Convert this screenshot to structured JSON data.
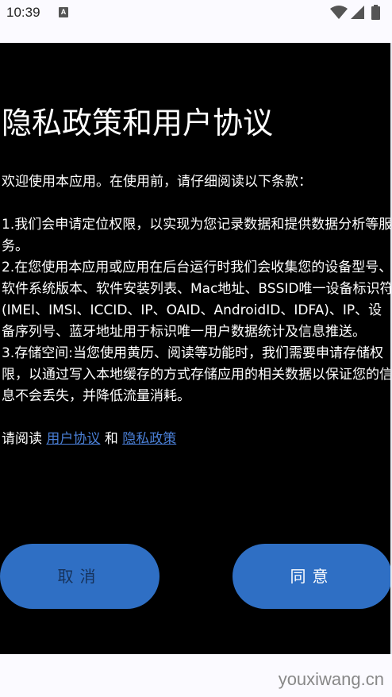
{
  "status_bar": {
    "time": "10:39",
    "notification_letter": "A",
    "icons": [
      "wifi-icon",
      "signal-icon",
      "battery-icon"
    ]
  },
  "dialog": {
    "title": "隐私政策和用户协议",
    "intro": "欢迎使用本应用。在使用前，请仔细阅读以下条款：",
    "terms": [
      "1.我们会申请定位权限，以实现为您记录数据和提供数据分析等服务。",
      "2.在您使用本应用或应用在后台运行时我们会收集您的设备型号、软件系统版本、软件安装列表、Mac地址、BSSID唯一设备标识符(IMEI、IMSI、ICCID、IP、OAID、AndroidID、IDFA)、IP、设备序列号、蓝牙地址用于标识唯一用户数据统计及信息推送。",
      "3.存储空间:当您使用黄历、阅读等功能时，我们需要申请存储权限，以通过写入本地缓存的方式存储应用的相关数据以保证您的信息不会丢失，并降低流量消耗。"
    ],
    "agree_prefix": "请阅读",
    "user_agreement_link": "用户协议",
    "conjunction": "和",
    "privacy_policy_link": "隐私政策",
    "cancel_label": "取消",
    "agree_label": "同意"
  },
  "watermark": "youxiwang.cn",
  "colors": {
    "dialog_background": "#000000",
    "button_blue": "#2f6fc4",
    "link_blue": "#4a7fd6",
    "cancel_text": "#16325a"
  }
}
